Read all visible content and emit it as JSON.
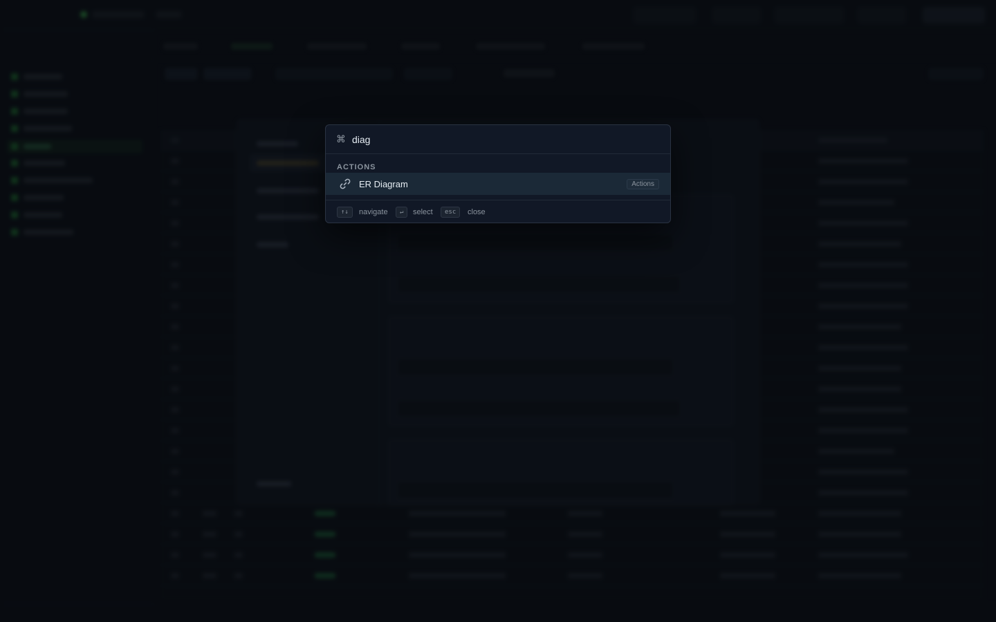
{
  "palette": {
    "command_glyph": "⌘",
    "query": "diag",
    "section_title": "ACTIONS",
    "results": [
      {
        "label": "ER Diagram",
        "badge": "Actions",
        "icon": "link-icon"
      }
    ],
    "footer": {
      "navigate_key": "↑↓",
      "navigate_label": "navigate",
      "select_key": "↵",
      "select_label": "select",
      "close_key": "esc",
      "close_label": "close"
    }
  },
  "colors": {
    "accent": "#3fb950",
    "selected_row": "#1b2937",
    "panel": "#111826"
  }
}
